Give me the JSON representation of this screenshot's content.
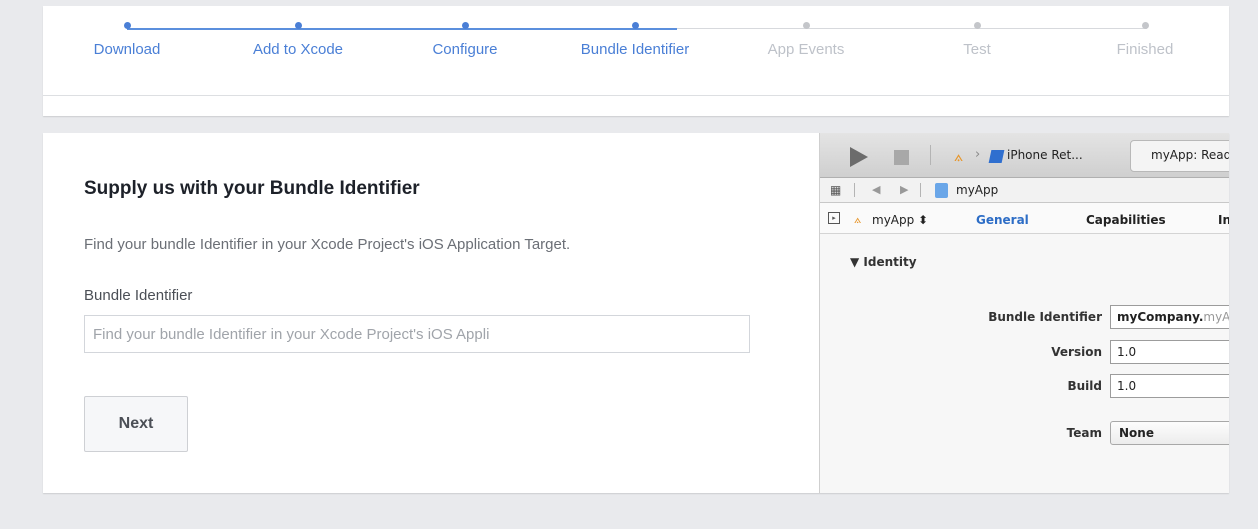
{
  "steps": [
    {
      "label": "Download",
      "state": "done"
    },
    {
      "label": "Add to Xcode",
      "state": "done"
    },
    {
      "label": "Configure",
      "state": "done"
    },
    {
      "label": "Bundle Identifier",
      "state": "current"
    },
    {
      "label": "App Events",
      "state": "todo"
    },
    {
      "label": "Test",
      "state": "todo"
    },
    {
      "label": "Finished",
      "state": "todo"
    }
  ],
  "form": {
    "title": "Supply us with your Bundle Identifier",
    "description": "Find your bundle Identifier in your Xcode Project's iOS Application Target.",
    "field_label": "Bundle Identifier",
    "field_placeholder": "Find your bundle Identifier in your Xcode Project's iOS Appli",
    "field_value": "",
    "next_label": "Next"
  },
  "xcode": {
    "device_label": "iPhone Ret...",
    "status_text": "myApp: Read",
    "jumpbar_label": "myApp",
    "target_label": "myApp ⬍",
    "tabs": [
      "General",
      "Capabilities",
      "In"
    ],
    "active_tab": "General",
    "section": "Identity",
    "bundle_id_label": "Bundle Identifier",
    "bundle_id_strong": "myCompany.",
    "bundle_id_rest": "myA",
    "version_label": "Version",
    "version_value": "1.0",
    "build_label": "Build",
    "build_value": "1.0",
    "team_label": "Team",
    "team_value": "None"
  },
  "colors": {
    "accent": "#4a7fd6",
    "inactive": "#bec2c9",
    "background": "#e9eaed"
  }
}
